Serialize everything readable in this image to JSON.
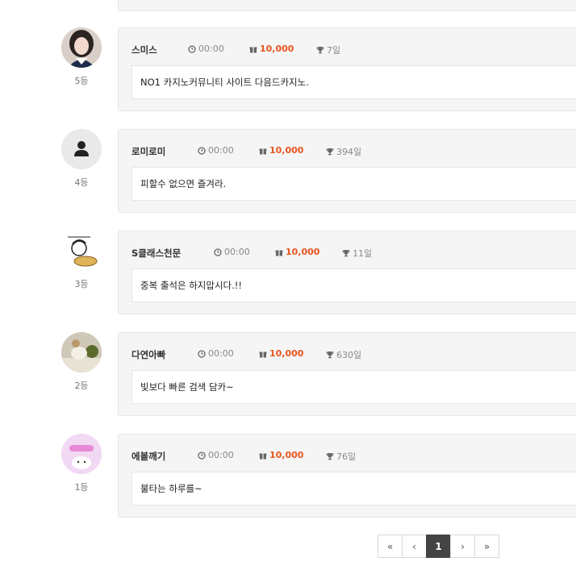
{
  "entries": [
    {
      "nick": "스미스",
      "time": "00:00",
      "points": "10,000",
      "days": "7일",
      "message": "NO1 카지노커뮤니티 사이트 다음드카지노.",
      "rank": "5등",
      "avatar": "photo-girl-avatar"
    },
    {
      "nick": "로미로미",
      "time": "00:00",
      "points": "10,000",
      "days": "394일",
      "message": "피할수 없으면 즐겨라.",
      "rank": "4등",
      "avatar": "default-user-avatar"
    },
    {
      "nick": "S클래스천문",
      "time": "00:00",
      "points": "10,000",
      "days": "11일",
      "message": "중복 출석은 하지맙시다.!!",
      "rank": "3등",
      "avatar": "cartoon-sketch-avatar"
    },
    {
      "nick": "다연아빠",
      "time": "00:00",
      "points": "10,000",
      "days": "630일",
      "message": "빛보다 빠른 검색 담카~",
      "rank": "2등",
      "avatar": "cat-photo-avatar"
    },
    {
      "nick": "에볼깨기",
      "time": "00:00",
      "points": "10,000",
      "days": "76일",
      "message": "불타는 하루를~",
      "rank": "1등",
      "avatar": "pink-character-avatar"
    }
  ],
  "pagination": {
    "first": "«",
    "prev": "‹",
    "current": "1",
    "next": "›",
    "last": "»"
  },
  "colors": {
    "points": "#e8541f",
    "card_bg": "#f5f5f5",
    "active_page": "#444444"
  }
}
